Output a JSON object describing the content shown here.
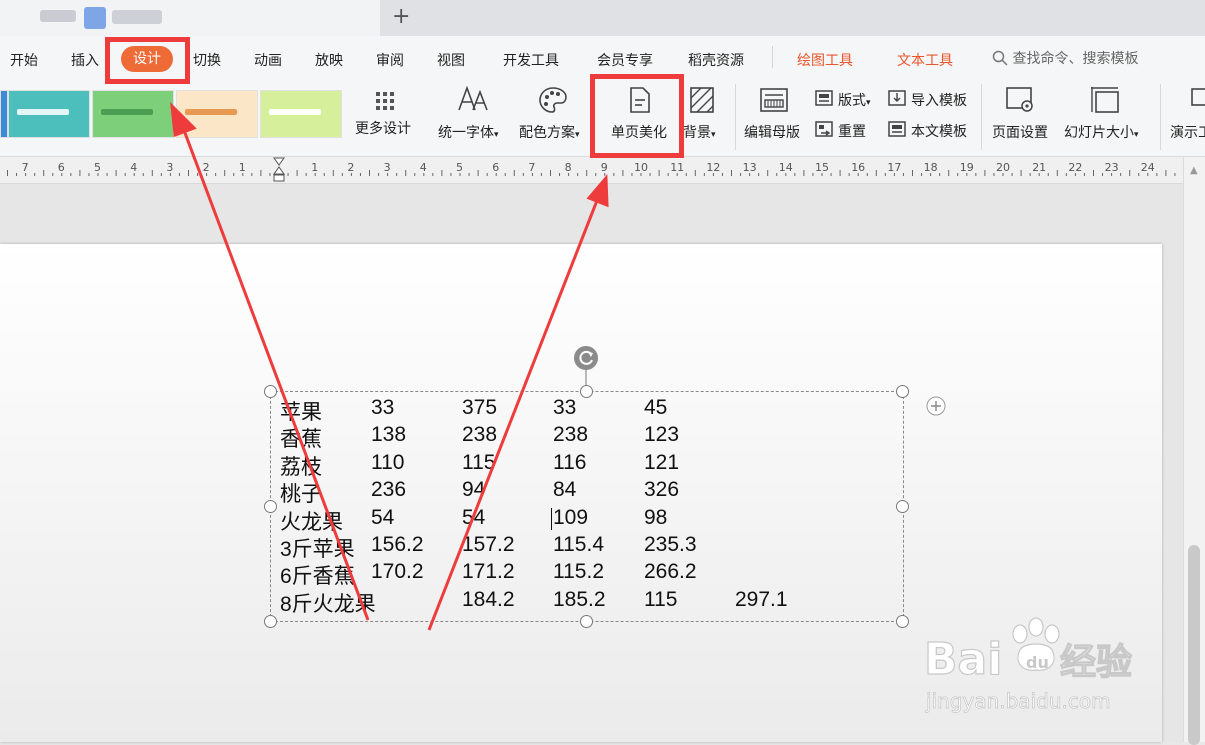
{
  "tabbar": {
    "new_tab": "+"
  },
  "menu": {
    "items": [
      "开始",
      "插入",
      "设计",
      "切换",
      "动画",
      "放映",
      "审阅",
      "视图",
      "开发工具",
      "会员专享",
      "稻壳资源"
    ],
    "context_tabs": [
      "绘图工具",
      "文本工具"
    ],
    "search_placeholder": "查找命令、搜索模板",
    "active": "设计",
    "accent_color": "#ee6a36"
  },
  "ribbon": {
    "more_design": "更多设计",
    "unify_font": "统一字体",
    "color_scheme": "配色方案",
    "single_page_beautify": "单页美化",
    "background": "背景",
    "edit_master": "编辑母版",
    "layout": "版式",
    "reset": "重置",
    "import_template": "导入模板",
    "this_template": "本文模板",
    "page_setup": "页面设置",
    "slide_size": "幻灯片大小",
    "present": "演示工"
  },
  "ruler": {
    "left": [
      "7",
      "6",
      "5",
      "4",
      "3",
      "2",
      "1"
    ],
    "right": [
      "1",
      "2",
      "3",
      "4",
      "5",
      "6",
      "7",
      "8",
      "9",
      "10",
      "11",
      "12",
      "13",
      "14",
      "15",
      "16",
      "17",
      "18",
      "19",
      "20",
      "21",
      "22",
      "23",
      "24"
    ]
  },
  "table_rows": [
    [
      "苹果",
      "33",
      "375",
      "33",
      "45",
      ""
    ],
    [
      "香蕉",
      "138",
      "238",
      "238",
      "123",
      ""
    ],
    [
      "荔枝",
      "110",
      "115",
      "116",
      "121",
      ""
    ],
    [
      "桃子",
      "236",
      "94",
      "84",
      "326",
      ""
    ],
    [
      "火龙果",
      "54",
      "54",
      "109",
      "98",
      ""
    ],
    [
      "3斤苹果",
      "156.2",
      "157.2",
      "115.4",
      "235.3",
      ""
    ],
    [
      "6斤香蕉",
      "170.2",
      "171.2",
      "115.2",
      "266.2",
      ""
    ],
    [
      "8斤火龙果",
      "",
      "184.2",
      "185.2",
      "115",
      "297.1"
    ]
  ],
  "watermark": {
    "brand": "Bai",
    "brand2": "du",
    "cn": "经验",
    "url": "jingyan.baidu.com"
  },
  "annotation_color": "#ee3b3b"
}
